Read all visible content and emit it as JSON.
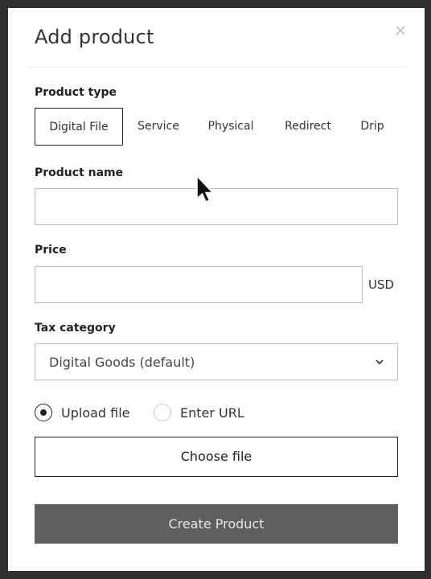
{
  "modal": {
    "title": "Add product"
  },
  "product_type": {
    "label": "Product type",
    "options": [
      "Digital File",
      "Service",
      "Physical",
      "Redirect",
      "Drip"
    ],
    "selected": "Digital File"
  },
  "product_name": {
    "label": "Product name",
    "value": "",
    "placeholder": ""
  },
  "price": {
    "label": "Price",
    "value": "",
    "placeholder": "",
    "currency": "USD"
  },
  "tax_category": {
    "label": "Tax category",
    "selected": "Digital Goods (default)"
  },
  "delivery": {
    "options": [
      "Upload file",
      "Enter URL"
    ],
    "selected": "Upload file"
  },
  "buttons": {
    "choose_file": "Choose file",
    "create_product": "Create Product"
  },
  "icons": {
    "close": "close-icon",
    "chevron": "chevron-down-icon",
    "cursor": "mouse-pointer-icon"
  },
  "colors": {
    "backdrop": "#2f3230",
    "primary_button": "#5f5f5f",
    "border": "#bdbdbd"
  }
}
